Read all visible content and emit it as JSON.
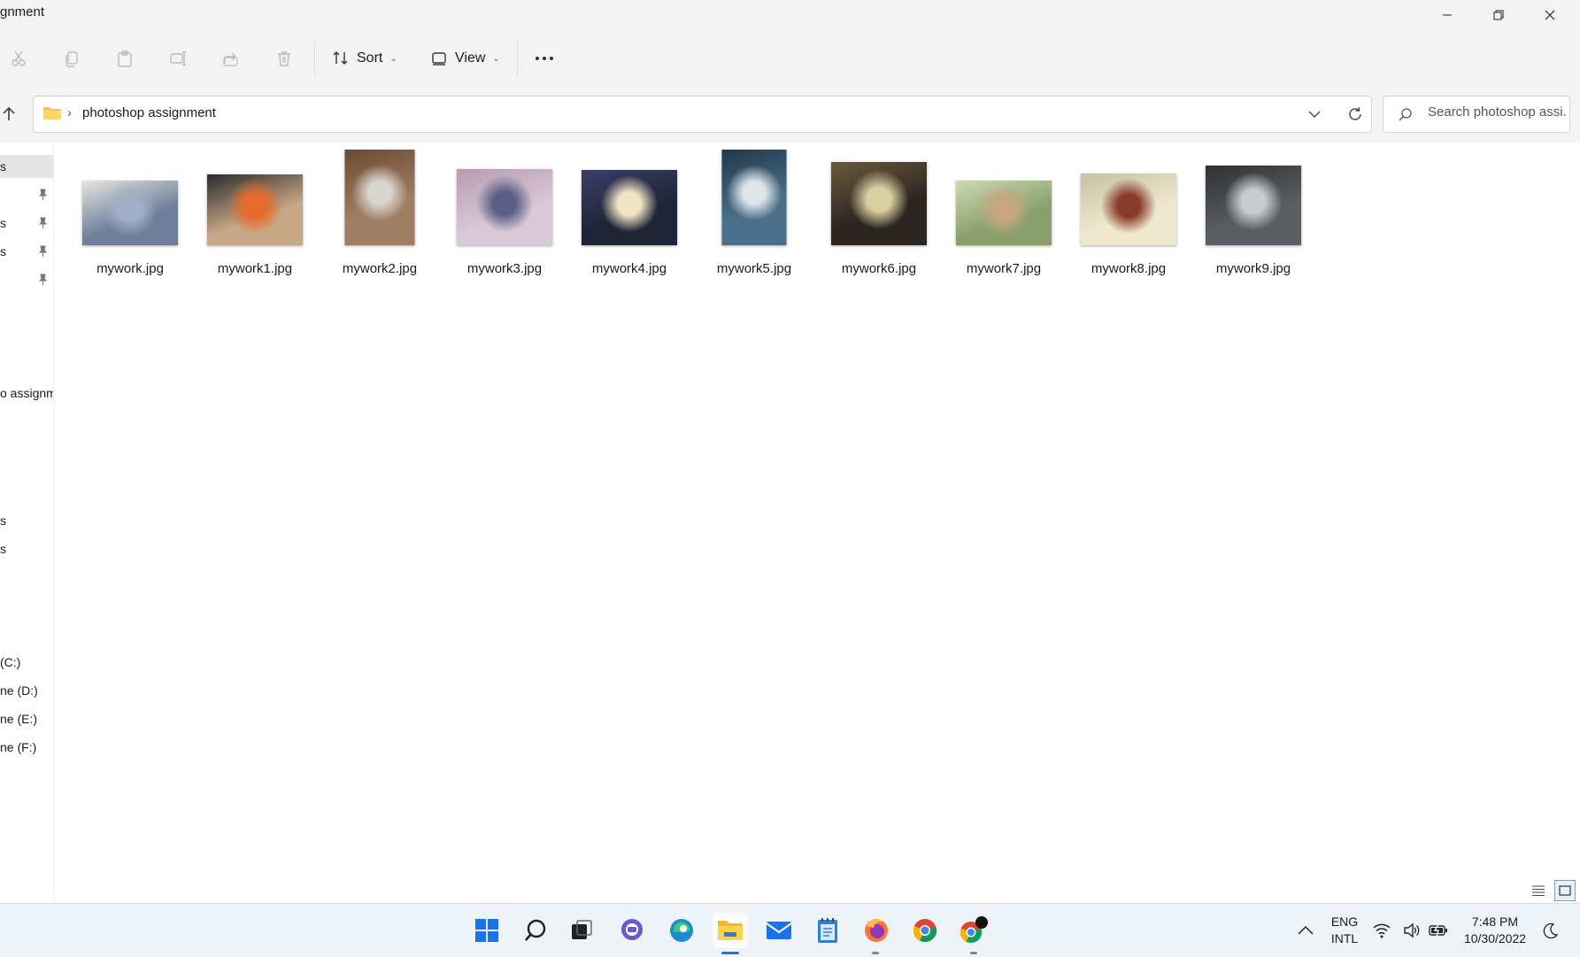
{
  "window": {
    "title": "gnment",
    "minimize_icon": "minimize-icon",
    "restore_icon": "restore-icon",
    "close_icon": "close-icon"
  },
  "toolbar": {
    "cut_icon": "scissors-icon",
    "copy_icon": "copy-icon",
    "paste_icon": "paste-icon",
    "rename_icon": "rename-icon",
    "share_icon": "share-icon",
    "delete_icon": "trash-icon",
    "sort_label": "Sort",
    "view_label": "View",
    "more_icon": "more-dots-icon"
  },
  "address": {
    "up_icon": "arrow-up-icon",
    "folder_icon": "folder-icon",
    "path": "photoshop assignment",
    "search_placeholder": "Search photoshop assi..."
  },
  "nav": {
    "items": [
      {
        "label": "s"
      },
      {
        "label": ""
      },
      {
        "label": "s"
      },
      {
        "label": "s"
      },
      {
        "label": ""
      },
      {
        "label": "o assignm"
      },
      {
        "label": "s"
      },
      {
        "label": "s"
      },
      {
        "label": "(C:)"
      },
      {
        "label": "ne (D:)"
      },
      {
        "label": "ne (E:)"
      },
      {
        "label": "ne (F:)"
      }
    ]
  },
  "files": [
    {
      "name": "mywork.jpg",
      "colors": [
        "#6d7f9a",
        "#9fb0c8",
        "#e8e4e0"
      ]
    },
    {
      "name": "mywork1.jpg",
      "colors": [
        "#c9a887",
        "#e46b2c",
        "#2a2a2a"
      ]
    },
    {
      "name": "mywork2.jpg",
      "colors": [
        "#a07e63",
        "#d8d4d0",
        "#6b4a34"
      ]
    },
    {
      "name": "mywork3.jpg",
      "colors": [
        "#d8c8d8",
        "#5a5f86",
        "#b89bb0"
      ]
    },
    {
      "name": "mywork4.jpg",
      "colors": [
        "#1f2436",
        "#f1e3c4",
        "#3b3f66"
      ]
    },
    {
      "name": "mywork5.jpg",
      "colors": [
        "#4b6f8a",
        "#dde5ea",
        "#20384c"
      ]
    },
    {
      "name": "mywork6.jpg",
      "colors": [
        "#2b2420",
        "#d9cfa0",
        "#6c5a3c"
      ]
    },
    {
      "name": "mywork7.jpg",
      "colors": [
        "#8aa06a",
        "#c6a680",
        "#cfd9b4"
      ]
    },
    {
      "name": "mywork8.jpg",
      "colors": [
        "#eee8cf",
        "#8a3a2a",
        "#c7c1a2"
      ]
    },
    {
      "name": "mywork9.jpg",
      "colors": [
        "#5a5d62",
        "#c9cbcc",
        "#2e3034"
      ]
    }
  ],
  "taskbar": {
    "apps": [
      "windows-start-icon",
      "search-icon",
      "task-view-icon",
      "teams-chat-icon",
      "edge-icon",
      "file-explorer-icon",
      "mail-icon",
      "notepad-icon",
      "firefox-icon",
      "chrome-icon",
      "chrome-profile-icon"
    ],
    "language_top": "ENG",
    "language_bottom": "INTL",
    "time": "7:48 PM",
    "date": "10/30/2022"
  }
}
